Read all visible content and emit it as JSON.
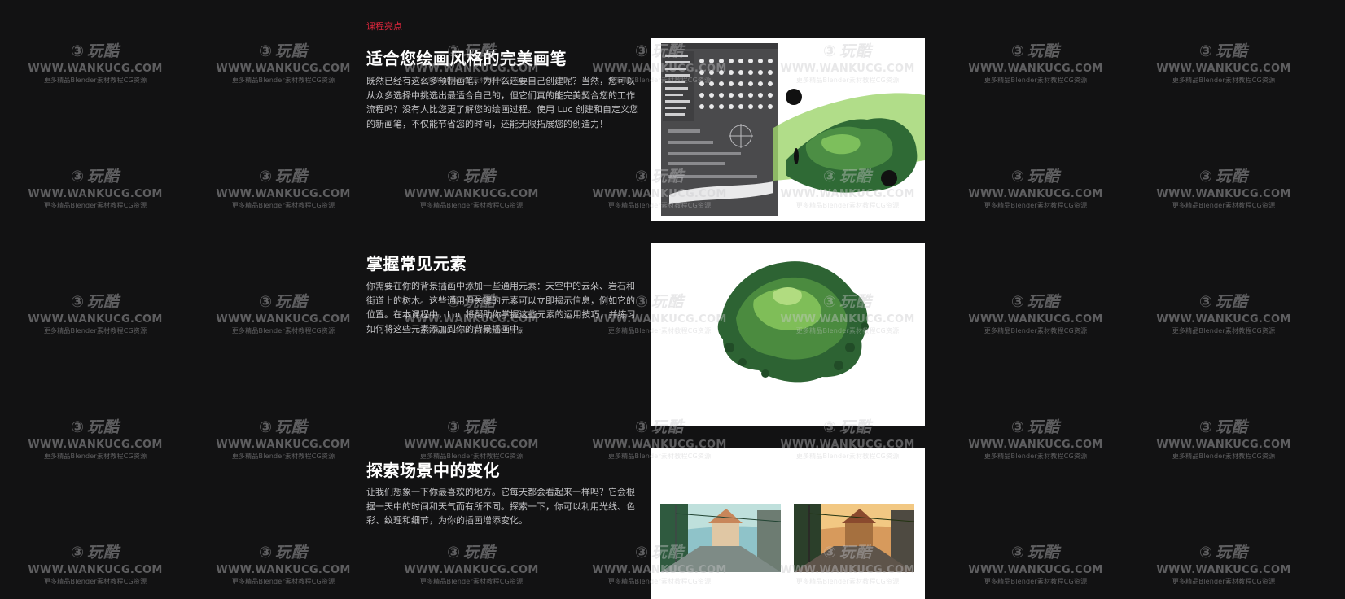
{
  "section": {
    "eyebrow": "课程亮点"
  },
  "highlights": [
    {
      "title": "适合您绘画风格的完美画笔",
      "body": "既然已经有这么多预制画笔，为什么还要自己创建呢？当然，您可以从众多选择中挑选出最适合自己的，但它们真的能完美契合您的工作流程吗？没有人比您更了解您的绘画过程。使用 Luc 创建和自定义您的新画笔，不仅能节省您的时间，还能无限拓展您的创造力！",
      "image": "brush-settings-and-tree-painting"
    },
    {
      "title": "掌握常见元素",
      "body": "你需要在你的背景插画中添加一些通用元素：天空中的云朵、岩石和街道上的树木。这些通用但关键的元素可以立即揭示信息，例如它的位置。在本课程中，Luc 将帮助你掌握这些元素的运用技巧，并练习如何将这些元素添加到你的背景插画中。",
      "image": "green-tree-sketch"
    },
    {
      "title": "探索场景中的变化",
      "body": "让我们想象一下你最喜欢的地方。它每天都会看起来一样吗？它会根据一天中的时间和天气而有所不同。探索一下，你可以利用光线、色彩、纹理和细节，为你的插画增添变化。",
      "image": "street-scene-day-and-sunset"
    }
  ],
  "watermark": {
    "logo": "玩酷",
    "url": "WWW.WANKUCG.COM",
    "tagline": "更多精品Blender素材教程CG资源"
  },
  "colors": {
    "background": "#121213",
    "accent": "#d6263b",
    "title": "#ffffff",
    "body_text": "#c2c2c5"
  }
}
